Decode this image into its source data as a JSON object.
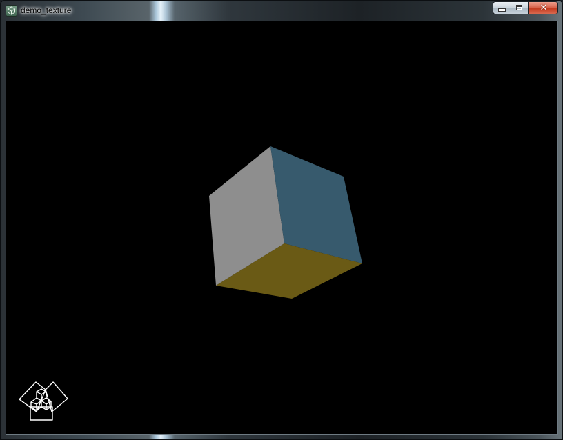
{
  "window": {
    "title": "demo_texture",
    "app_icon": "app-icon"
  },
  "caption_buttons": {
    "minimize_icon": "minimize-icon",
    "maximize_icon": "maximize-icon",
    "close_icon": "close-icon",
    "close_glyph": "✕"
  },
  "scene": {
    "background_color": "#000000",
    "cube": {
      "faces": [
        {
          "name": "left-face",
          "color": "#8e8e8e"
        },
        {
          "name": "right-face",
          "color": "#375a6d"
        },
        {
          "name": "bottom-face",
          "color": "#6a5a15"
        }
      ]
    },
    "view_cube_icon": "view-cube-navigation-icon"
  }
}
